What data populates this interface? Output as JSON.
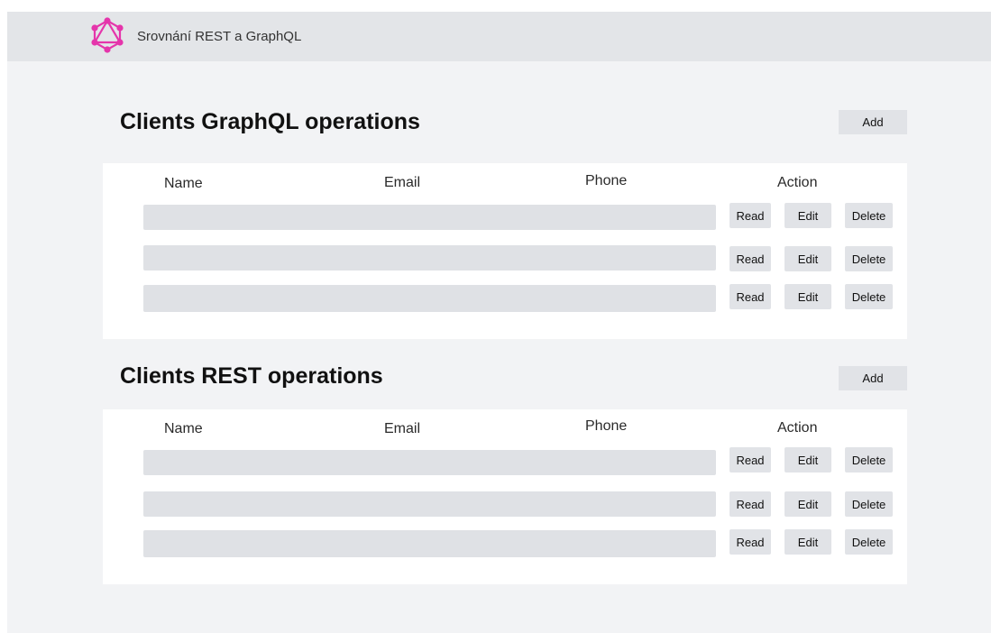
{
  "app": {
    "title": "Srovnání REST a GraphQL",
    "logo_icon": "graphql-logo-icon",
    "accent_color": "#e535ab"
  },
  "columns": {
    "name": "Name",
    "email": "Email",
    "phone": "Phone",
    "action": "Action"
  },
  "actions": {
    "read": "Read",
    "edit": "Edit",
    "delete": "Delete"
  },
  "sections": [
    {
      "title": "Clients GraphQL operations",
      "add_label": "Add",
      "rows": [
        {},
        {},
        {}
      ]
    },
    {
      "title": "Clients REST operations",
      "add_label": "Add",
      "rows": [
        {},
        {},
        {}
      ]
    }
  ]
}
